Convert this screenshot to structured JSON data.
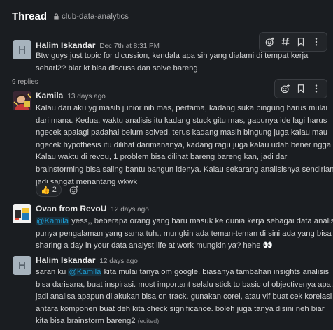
{
  "header": {
    "title": "Thread",
    "channel": "club-data-analytics"
  },
  "parent": {
    "avatar_letter": "H",
    "name": "Halim Iskandar",
    "time": "Dec 7th at 8:31 PM",
    "lines": [
      "Btw guys just topic for dicussion, kendala apa sih yang dialami di tempat kerja",
      "sehari2? biar kt bisa discuss dan solve bareng"
    ]
  },
  "replies_label": "9 replies",
  "replies": [
    {
      "name": "Kamila",
      "time": "13 days ago",
      "lines": [
        "Kalau dari aku yg masih junior nih mas, pertama, kadang suka bingung harus mulai",
        "dari mana. Kedua, waktu analisis itu kadang stuck gitu mas, gapunya ide lagi harus",
        "ngecek apalagi padahal belum solved, terus kadang masih bingung juga kalau mau",
        "ngecek hypothesis itu dilihat darimananya, kadang ragu juga kalau udah bener ngga ya.",
        "Kalau waktu di revou, 1 problem bisa dilihat bareng bareng kan, jadi dari",
        "brainstorming bisa saling bantu bangun idenya. Kalau sekarang analisisnya sendirian,",
        "jadi sangat menantang wkwk"
      ],
      "reaction": {
        "emoji": "👍",
        "count": "2"
      }
    },
    {
      "name": "Ovan from RevoU",
      "time": "12 days ago",
      "mention": "@Kamila",
      "line1_rest": " yess,, beberapa orang yang baru masuk ke dunia kerja sebagai data analis",
      "lines": [
        "punya pengalaman yang sama tuh.. mungkin ada teman-teman di sini ada yang bisa",
        "sharing a day in your data analyst life at work mungkin ya? hehe 👀"
      ]
    },
    {
      "avatar_letter": "H",
      "name": "Halim Iskandar",
      "time": "12 days ago",
      "line1_pre": "saran ku ",
      "mention": "@Kamila",
      "line1_rest": " kita mulai tanya om google. biasanya tambahan insights analisis",
      "lines": [
        "bisa darisana, buat inspirasi. most important selalu stick to basic of objectivenya apa,",
        "jadi analisa apapun dilakukan bisa on track. gunakan corel, atau vif buat cek korelasi",
        "antara komponen buat deh kita check significance. boleh juga tanya disini neh biar"
      ],
      "last_line": "kita bisa brainstorm bareng2 ",
      "edited": "(edited)"
    }
  ],
  "colors": {
    "background": "#1a1d21",
    "mention": "#1d9bd1",
    "text": "#d1d2d3"
  },
  "icons": [
    "lock-icon",
    "add-reaction-icon",
    "hashtag-icon",
    "bookmark-icon",
    "more-vertical-icon"
  ]
}
